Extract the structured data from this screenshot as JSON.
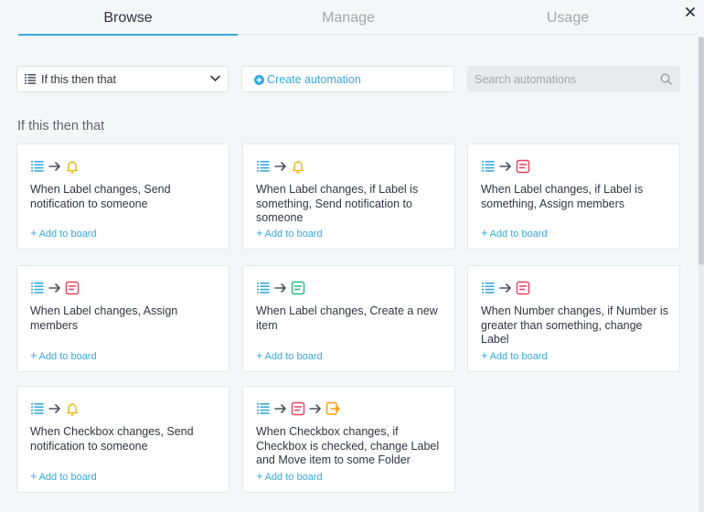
{
  "tabs": [
    {
      "label": "Browse",
      "active": true
    },
    {
      "label": "Manage",
      "active": false
    },
    {
      "label": "Usage",
      "active": false
    }
  ],
  "close_icon": "close-icon",
  "toolbar": {
    "category_select": "If this then that",
    "create_label": "Create automation",
    "search_placeholder": "Search automations"
  },
  "section_title": "If this then that",
  "colors": {
    "accent": "#36a9e1",
    "trigger_icon": "#36a9e1",
    "bell": "#f4b400",
    "pink": "#e2445c",
    "green": "#2eb67d",
    "orange": "#f59e0b"
  },
  "cards": [
    {
      "icons": [
        "list-icon",
        "arrow-icon",
        "bell-icon"
      ],
      "text": "When Label changes, Send notification to someone",
      "add": "Add to board"
    },
    {
      "icons": [
        "list-icon",
        "arrow-icon",
        "bell-icon"
      ],
      "text": "When Label changes, if Label is something, Send notification to someone",
      "add": "Add to board"
    },
    {
      "icons": [
        "list-icon",
        "arrow-icon",
        "form-icon-pink"
      ],
      "text": "When Label changes, if Label is something, Assign members",
      "add": "Add to board"
    },
    {
      "icons": [
        "list-icon",
        "arrow-icon",
        "form-icon-pink"
      ],
      "text": "When Label changes, Assign members",
      "add": "Add to board"
    },
    {
      "icons": [
        "list-icon",
        "arrow-icon",
        "form-icon-green"
      ],
      "text": "When Label changes, Create a new item",
      "add": "Add to board"
    },
    {
      "icons": [
        "list-icon",
        "arrow-icon",
        "form-icon-pink"
      ],
      "text": "When Number changes, if Number is greater than something, change Label",
      "add": "Add to board"
    },
    {
      "icons": [
        "list-icon",
        "arrow-icon",
        "bell-icon"
      ],
      "text": "When Checkbox changes, Send notification to someone",
      "add": "Add to board"
    },
    {
      "icons": [
        "list-icon",
        "arrow-icon",
        "form-icon-pink",
        "arrow-icon",
        "move-icon"
      ],
      "text": "When Checkbox changes, if Checkbox is checked, change Label and Move item to some Folder",
      "add": "Add to board"
    }
  ]
}
